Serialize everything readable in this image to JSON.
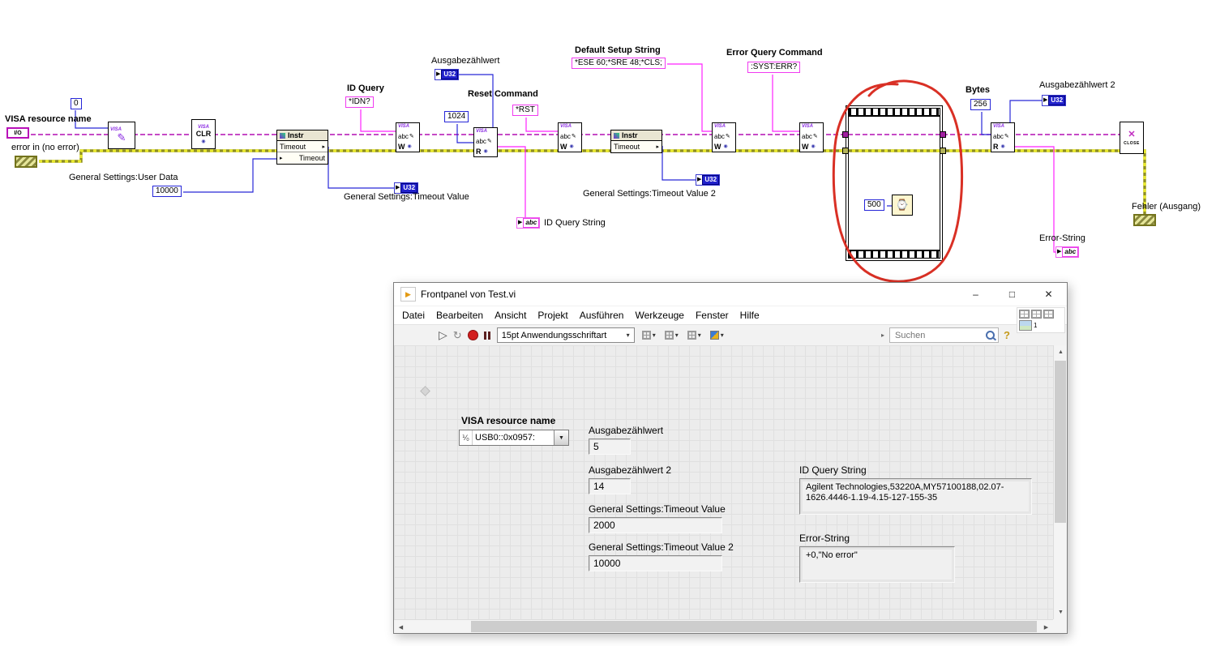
{
  "diagram": {
    "labels": {
      "visa_resource_name": "VISA resource name",
      "error_in": "error in (no error)",
      "user_data": "General Settings:User Data",
      "id_query": "ID Query",
      "ausgabezaehlwert": "Ausgabezählwert",
      "reset_command": "Reset Command",
      "timeout_value": "General Settings:Timeout Value",
      "id_query_string": "ID Query String",
      "default_setup_string": "Default Setup String",
      "timeout_value_2": "General Settings:Timeout Value 2",
      "error_query_command": "Error Query Command",
      "bytes": "Bytes",
      "ausgabezaehlwert_2": "Ausgabezählwert 2",
      "fehler_ausgang": "Fehler (Ausgang)",
      "error_string": "Error-String"
    },
    "constants": {
      "zero": "0",
      "user_data_value": "10000",
      "idn_query": "*IDN?",
      "count_1024": "1024",
      "rst": "*RST",
      "default_setup": "*ESE 60;*SRE 48;*CLS;",
      "error_query": ":SYST:ERR?",
      "bytes_256": "256",
      "wait_ms": "500"
    },
    "nodes": {
      "visa": "VISA",
      "clr": "CLR",
      "close_label": "CLOSE",
      "abc": "abc",
      "write": "W",
      "read": "R",
      "instr": "Instr",
      "timeout": "Timeout",
      "u32": "U32",
      "io": "I/O"
    }
  },
  "window": {
    "title": "Frontpanel von Test.vi",
    "menus": [
      "Datei",
      "Bearbeiten",
      "Ansicht",
      "Projekt",
      "Ausführen",
      "Werkzeuge",
      "Fenster",
      "Hilfe"
    ],
    "toolbar": {
      "font_selector": "15pt Anwendungsschriftart",
      "search_placeholder": "Suchen"
    },
    "panel": {
      "visa_resource": {
        "label": "VISA resource name",
        "value": "USB0::0x0957:"
      },
      "ausgabe1": {
        "label": "Ausgabezählwert",
        "value": "5"
      },
      "ausgabe2": {
        "label": "Ausgabezählwert 2",
        "value": "14"
      },
      "timeout1": {
        "label": "General Settings:Timeout Value",
        "value": "2000"
      },
      "timeout2": {
        "label": "General Settings:Timeout Value 2",
        "value": "10000"
      },
      "id_query_string": {
        "label": "ID Query String",
        "value": "Agilent Technologies,53220A,MY57100188,02.07-1626.4446-1.19-4.15-127-155-35"
      },
      "error_string": {
        "label": "Error-String",
        "value": "+0,\"No error\""
      }
    },
    "nav_badge": "1"
  },
  "icons": {
    "run": "▷",
    "run_continuous": "↻",
    "dropdown": "▾",
    "minimize": "–",
    "maximize": "□",
    "close": "✕",
    "help": "?",
    "up": "▲",
    "down": "▼",
    "left": "◀",
    "right": "▶",
    "chip_arrow": "▶",
    "prop_arrow": "▸",
    "pencil": "✎",
    "eye": "◉",
    "clock": "⌚",
    "io_glyph": "⅟₀",
    "lv_arrow": "▶"
  },
  "accent_colors": {
    "visa_wire": "#b30eb3",
    "string_wire": "#ff22ff",
    "numeric_wire": "#2828d8",
    "error_wire": "#8f8f1f",
    "annotation": "#d93025"
  }
}
